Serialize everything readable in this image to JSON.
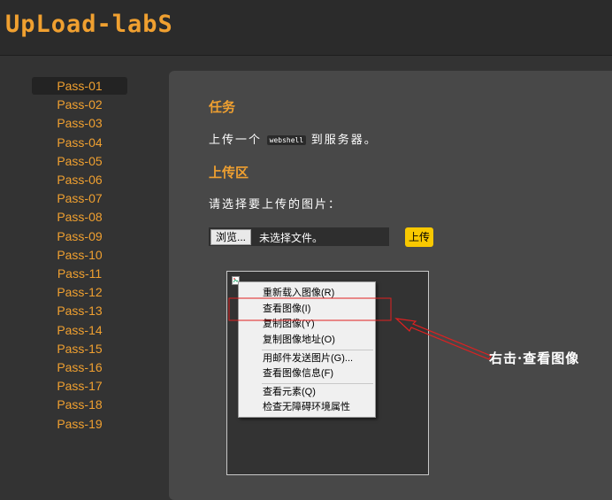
{
  "header": {
    "logo": "UpLoad-labS"
  },
  "sidebar": {
    "items": [
      "Pass-01",
      "Pass-02",
      "Pass-03",
      "Pass-04",
      "Pass-05",
      "Pass-06",
      "Pass-07",
      "Pass-08",
      "Pass-09",
      "Pass-10",
      "Pass-11",
      "Pass-12",
      "Pass-13",
      "Pass-14",
      "Pass-15",
      "Pass-16",
      "Pass-17",
      "Pass-18",
      "Pass-19"
    ]
  },
  "main": {
    "task_heading": "任务",
    "task_text_before": "上传一个",
    "task_code": "webshell",
    "task_text_after": "到服务器。",
    "upload_heading": "上传区",
    "select_prompt": "请选择要上传的图片：",
    "browse_label": "浏览...",
    "file_status": "未选择文件。",
    "upload_button": "上传"
  },
  "context_menu": {
    "items": [
      {
        "label": "重新载入图像(R)"
      },
      {
        "label": "查看图像(I)"
      },
      {
        "label": "复制图像(Y)"
      },
      {
        "label": "复制图像地址(O)"
      },
      {
        "label": "用邮件发送图片(G)..."
      },
      {
        "label": "查看图像信息(F)"
      },
      {
        "label": "查看元素(Q)"
      },
      {
        "label": "检查无障碍环境属性"
      }
    ]
  },
  "annotation": {
    "text": "右击·查看图像",
    "color": "#e02020"
  },
  "colors": {
    "accent": "#f0a030",
    "upload_button": "#f8c800",
    "highlight": "#e02020"
  }
}
